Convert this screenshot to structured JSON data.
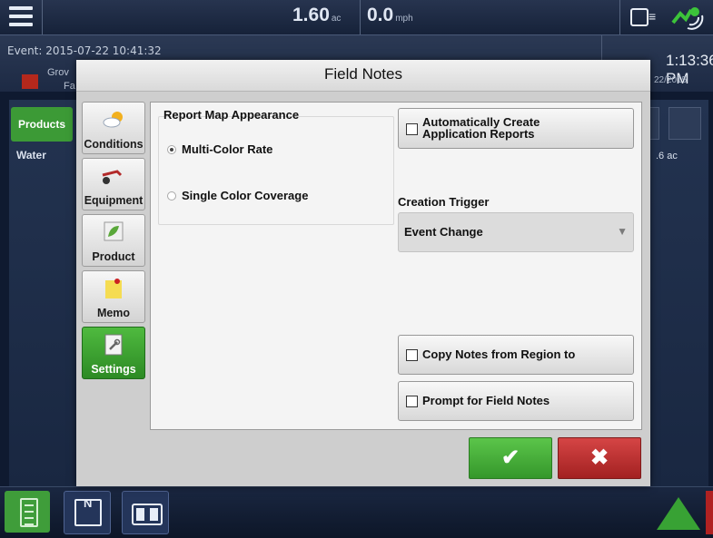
{
  "topbar": {
    "area_value": "1.60",
    "area_unit": "ac",
    "speed_value": "0.0",
    "speed_unit": "mph"
  },
  "event": {
    "label": "Event: 2015-07-22 10:41:32",
    "grower_fragment": "Grov",
    "farm_fragment": "Fa",
    "time_fragment": "1:13:36 PM",
    "date_fragment": "22/2015"
  },
  "background": {
    "products_tab": "Products",
    "product_row": "Water",
    "area_fragment": ".6 ac"
  },
  "dialog": {
    "title": "Field Notes",
    "sidebar": [
      {
        "label": "Conditions",
        "icon": "cloud-sun-icon"
      },
      {
        "label": "Equipment",
        "icon": "tractor-implement-icon"
      },
      {
        "label": "Product",
        "icon": "leaf-icon"
      },
      {
        "label": "Memo",
        "icon": "sticky-note-icon"
      },
      {
        "label": "Settings",
        "icon": "wrench-notepad-icon",
        "active": true
      }
    ],
    "report_map": {
      "title": "Report Map Appearance",
      "options": [
        {
          "label": "Multi-Color Rate",
          "selected": true
        },
        {
          "label": "Single Color Coverage",
          "selected": false
        }
      ]
    },
    "auto_create": {
      "line1": "Automatically Create",
      "line2": "Application Reports",
      "checked": false
    },
    "creation_trigger": {
      "label": "Creation Trigger",
      "value": "Event Change"
    },
    "copy_notes": {
      "label": "Copy Notes from Region to",
      "checked": false
    },
    "prompt_notes": {
      "label": "Prompt for Field Notes",
      "checked": false
    },
    "ok_symbol": "✔",
    "cancel_symbol": "✖"
  },
  "colors": {
    "accent_green": "#3c9a36",
    "cancel_red": "#b42a2a",
    "dialog_bg": "#cecece"
  }
}
